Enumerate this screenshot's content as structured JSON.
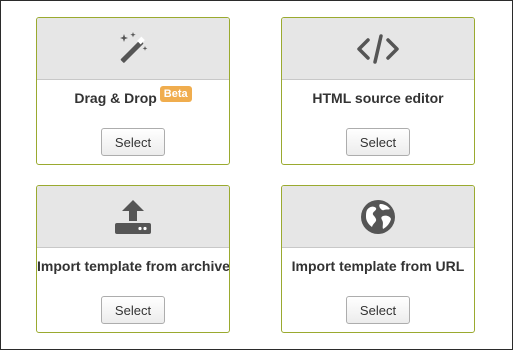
{
  "options": [
    {
      "title": "Drag & Drop",
      "badge": "Beta",
      "icon": "magic-wand-icon",
      "button_label": "Select"
    },
    {
      "title": "HTML source editor",
      "icon": "code-icon",
      "button_label": "Select"
    },
    {
      "title": "Import template from archive",
      "icon": "upload-icon",
      "button_label": "Select"
    },
    {
      "title": "Import template from URL",
      "icon": "globe-icon",
      "button_label": "Select"
    }
  ],
  "colors": {
    "card_border": "#9aaa2f",
    "card_header_bg": "#e6e6e6",
    "icon": "#555555",
    "badge_bg": "#f0ad4e",
    "title_text": "#333333"
  }
}
